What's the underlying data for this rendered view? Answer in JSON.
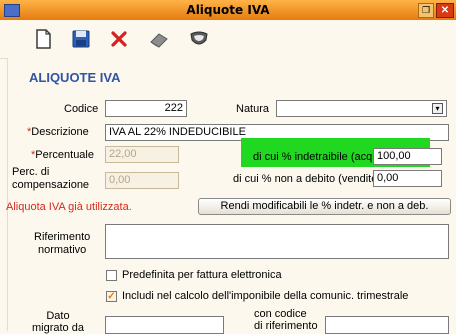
{
  "window": {
    "title": "Aliquote IVA"
  },
  "form": {
    "heading": "ALIQUOTE IVA",
    "codice_label": "Codice",
    "codice_value": "222",
    "natura_label": "Natura",
    "natura_value": "",
    "descrizione_label": "Descrizione",
    "descrizione_value": "IVA AL 22% INDEDUCIBILE",
    "percentuale_label": "Percentuale",
    "percentuale_value": "22,00",
    "indetraibile_label": "di cui % indetraibile (acquisti)",
    "indetraibile_value": "100,00",
    "perc_comp_label_1": "Perc. di",
    "perc_comp_label_2": "compensazione",
    "perc_comp_value": "0,00",
    "non_debito_label": "di cui % non a debito (vendite)",
    "non_debito_value": "0,00",
    "warning": "Aliquota IVA già utilizzata.",
    "rendi_button": "Rendi modificabili le % indetr. e non a deb.",
    "riferimento_label_1": "Riferimento",
    "riferimento_label_2": "normativo",
    "riferimento_value": "",
    "predefinita_label": "Predefinita per fattura elettronica",
    "includi_label": "Includi nel calcolo dell'imponibile della comunic. trimestrale",
    "dato_label_1": "Dato",
    "dato_label_2": "migrato da",
    "dato_value": "",
    "codice_rif_label_1": "con codice",
    "codice_rif_label_2": "di riferimento",
    "codice_rif_value": "",
    "required_mark": "*",
    "check_mark": "✓",
    "dropdown_arrow": "▾"
  },
  "icons": [
    "new-document-icon",
    "save-icon",
    "delete-icon",
    "eraser-icon",
    "shield-icon"
  ],
  "colors": {
    "titlebar": "#e47c10",
    "heading": "#2f54a8",
    "required": "#d42a1a",
    "highlight": "#1fd81f",
    "background": "#fdf8ed"
  }
}
